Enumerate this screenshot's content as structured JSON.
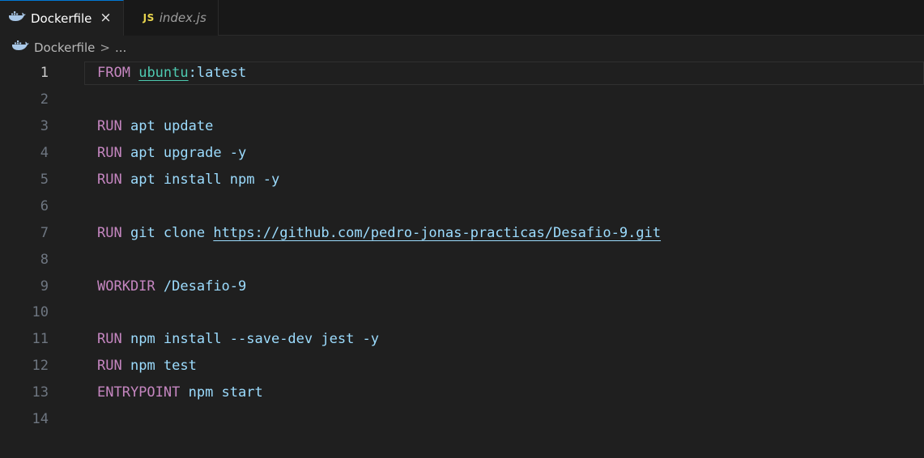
{
  "tabs": [
    {
      "label": "Dockerfile",
      "close": "×",
      "active": true
    },
    {
      "label": "index.js",
      "icon_text": "JS",
      "active": false
    }
  ],
  "breadcrumb": {
    "file": "Dockerfile",
    "separator": ">",
    "rest": "..."
  },
  "editor": {
    "lines": [
      {
        "n": "1",
        "kw": "FROM",
        "image": "ubuntu",
        "rest": ":latest"
      },
      {
        "n": "2"
      },
      {
        "n": "3",
        "kw": "RUN",
        "rest": "apt update"
      },
      {
        "n": "4",
        "kw": "RUN",
        "rest": "apt upgrade -y"
      },
      {
        "n": "5",
        "kw": "RUN",
        "rest": "apt install npm -y"
      },
      {
        "n": "6"
      },
      {
        "n": "7",
        "kw": "RUN",
        "rest": "git clone ",
        "url": "https://github.com/pedro-jonas-practicas/Desafio-9.git"
      },
      {
        "n": "8"
      },
      {
        "n": "9",
        "kw": "WORKDIR",
        "rest": "/Desafio-9"
      },
      {
        "n": "10"
      },
      {
        "n": "11",
        "kw": "RUN",
        "rest": "npm install --save-dev jest -y"
      },
      {
        "n": "12",
        "kw": "RUN",
        "rest": "npm test"
      },
      {
        "n": "13",
        "kw": "ENTRYPOINT",
        "rest": "npm start"
      },
      {
        "n": "14"
      }
    ]
  },
  "colors": {
    "keyword": "#c586c0",
    "text": "#9cdcfe",
    "image": "#4ec9b0",
    "background": "#1f1f1f"
  },
  "icons": {
    "dockerfile": "docker-whale-icon",
    "js": "js-file-icon",
    "close": "close-icon"
  }
}
